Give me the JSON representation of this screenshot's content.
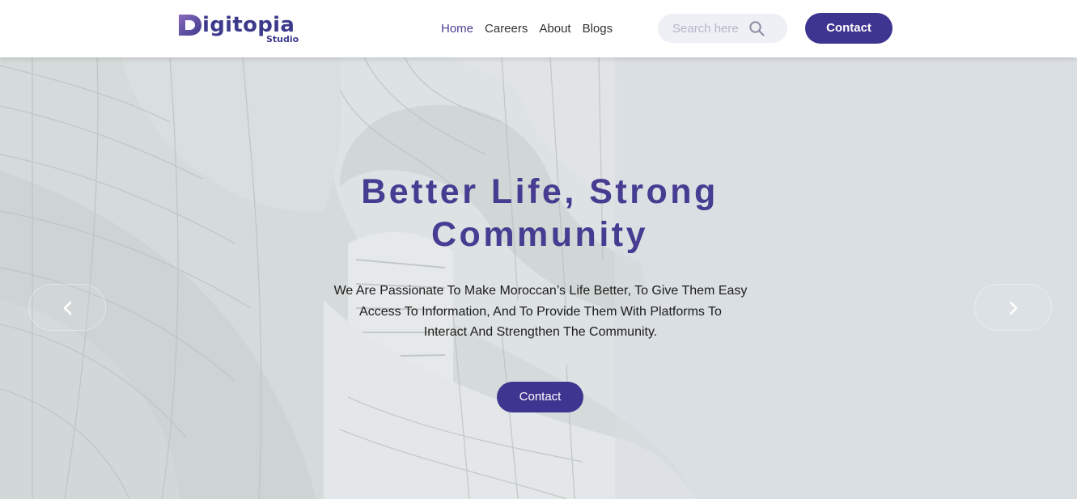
{
  "brand": {
    "logo_letter": "D",
    "logo_text": "igitopia",
    "logo_sub": "Studio"
  },
  "nav": {
    "items": [
      {
        "label": "Home",
        "active": true
      },
      {
        "label": "Careers",
        "active": false
      },
      {
        "label": "About",
        "active": false
      },
      {
        "label": "Blogs",
        "active": false
      }
    ]
  },
  "search": {
    "placeholder": "Search here",
    "value": "",
    "icon": "search-icon"
  },
  "header": {
    "contact_label": "Contact"
  },
  "hero": {
    "title_line1": "Better Life, Strong",
    "title_line2": "Community",
    "desc_line1": "We Are Passionate To Make Moroccan’s Life Better, To Give Them Easy",
    "desc_line2": "Access To Information, And To Provide Them With Platforms To",
    "desc_line3": "Interact And Strengthen The Community.",
    "button_label": "Contact",
    "prev_icon": "chevron-left-icon",
    "next_icon": "chevron-right-icon"
  },
  "colors": {
    "brand": "#3e3590",
    "title": "#463c91",
    "nav_active": "#4a3f93",
    "search_bg": "#eef0f6"
  }
}
